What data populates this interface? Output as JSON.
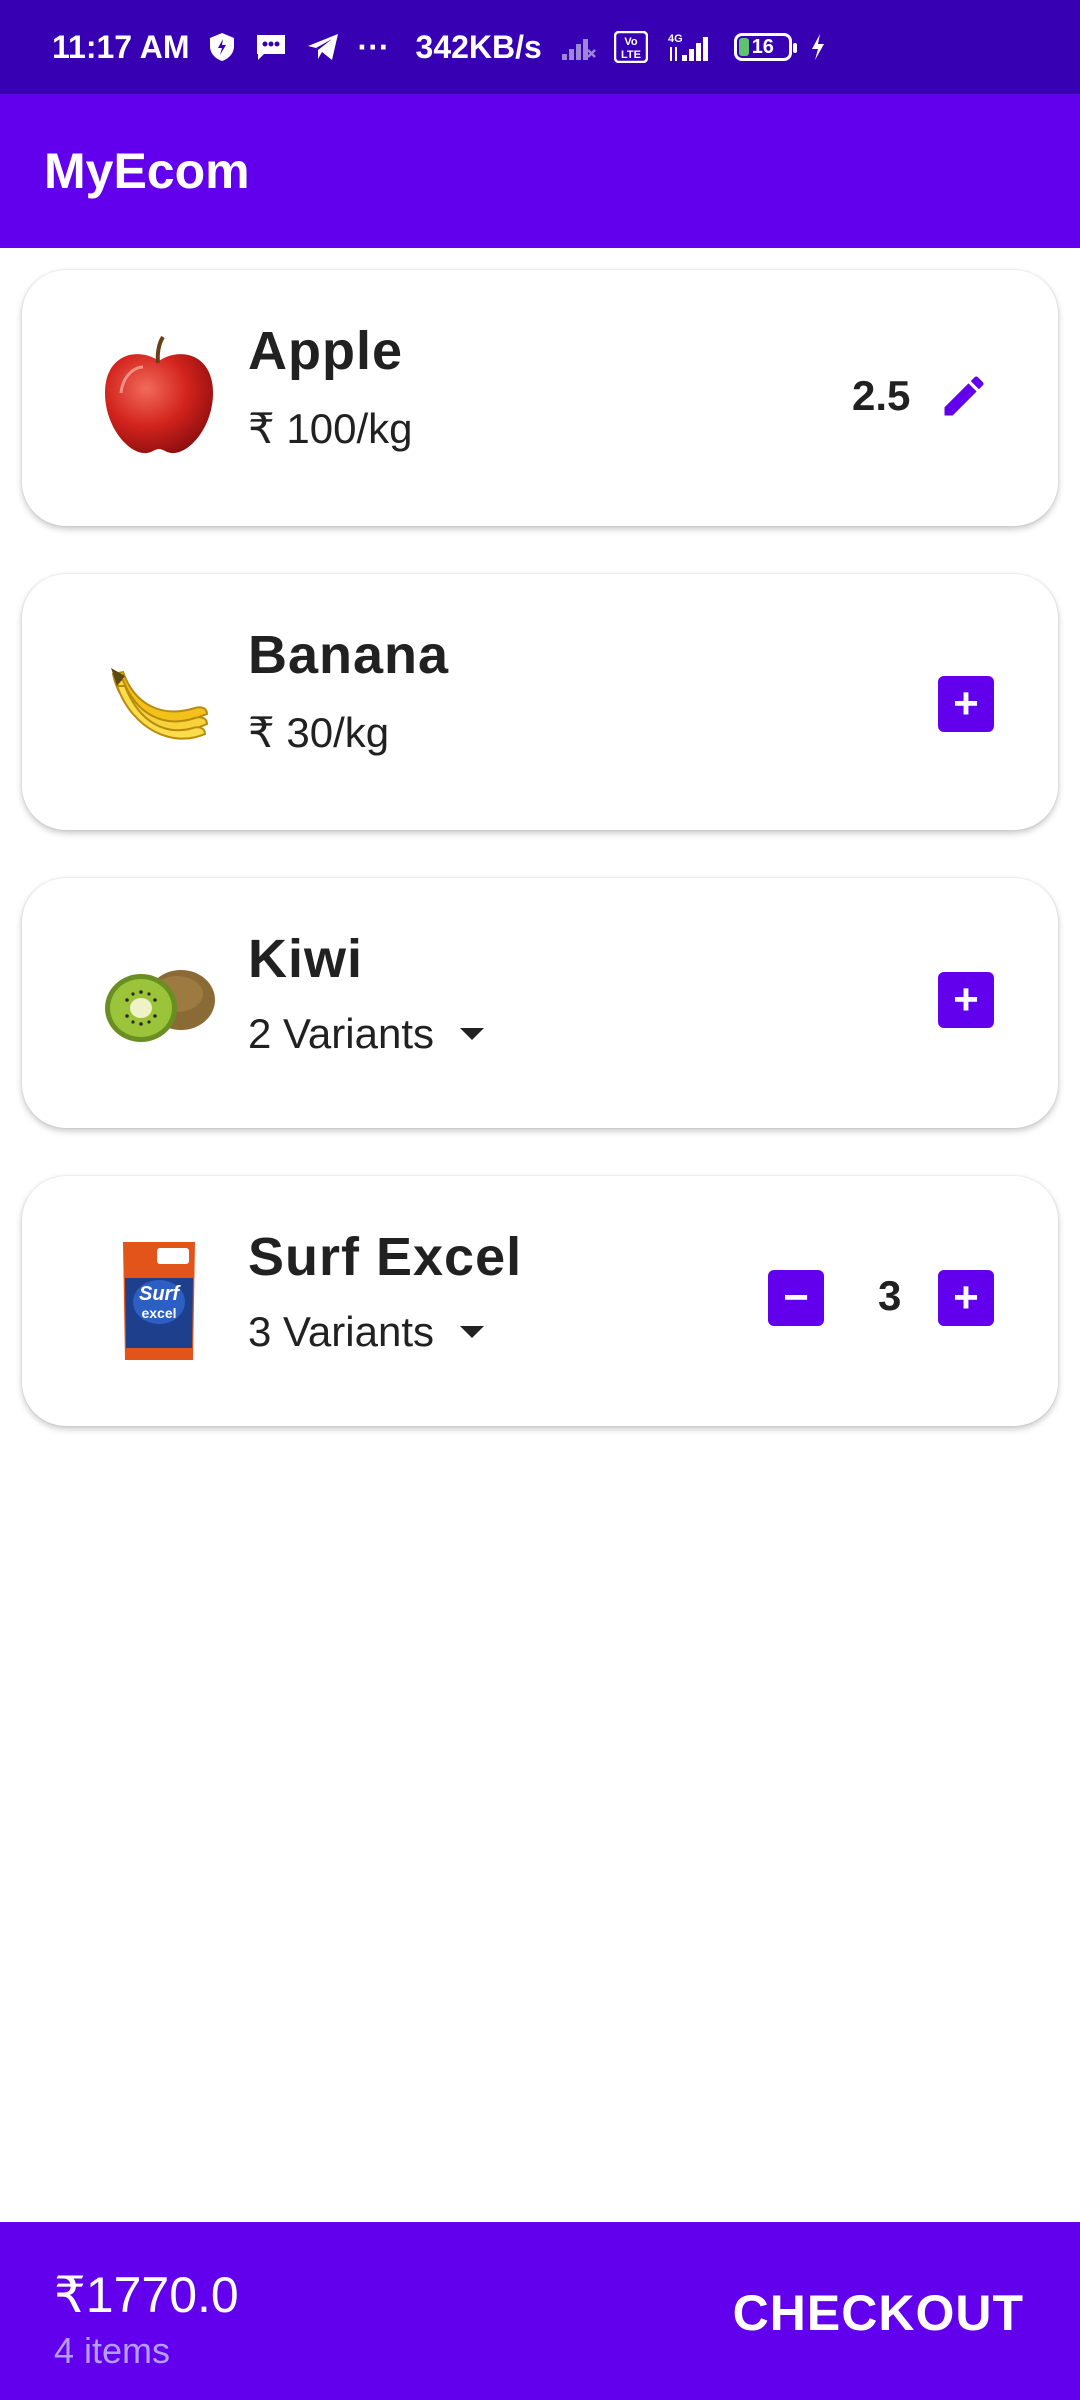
{
  "status_bar": {
    "time": "11:17 AM",
    "dots": "···",
    "network_speed": "342KB/s",
    "volte_label": "Vo LTE",
    "network_type": "4G",
    "battery": "16"
  },
  "app_bar": {
    "title": "MyEcom"
  },
  "products": [
    {
      "name": "Apple",
      "info": "₹ 100/kg",
      "quantity": "2.5",
      "image_icon": "apple-image"
    },
    {
      "name": "Banana",
      "info": "₹ 30/kg",
      "add": "+",
      "image_icon": "banana-image"
    },
    {
      "name": "Kiwi",
      "info": "2 Variants",
      "add": "+",
      "image_icon": "kiwi-image"
    },
    {
      "name": "Surf Excel",
      "info": "3 Variants",
      "quantity": "3",
      "minus": "−",
      "add": "+",
      "image_icon": "detergent-pack-image"
    }
  ],
  "cart": {
    "total": "₹1770.0",
    "items": "4 items",
    "checkout_label": "CHECKOUT"
  },
  "colors": {
    "status_bar": "#3700b3",
    "primary": "#6200ee",
    "muted_purple": "#b59cff"
  }
}
